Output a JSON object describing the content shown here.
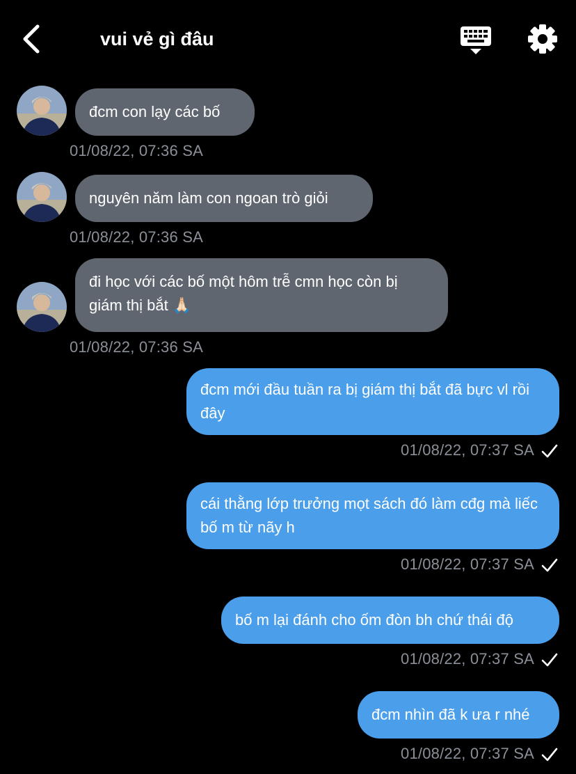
{
  "header": {
    "title": "vui vẻ gì đâu",
    "back_icon": "chevron-left-icon",
    "keyboard_icon": "keyboard-icon",
    "settings_icon": "gear-icon"
  },
  "colors": {
    "background": "#000000",
    "incoming_bubble": "#5f6670",
    "outgoing_bubble": "#4a9eea",
    "timestamp": "#8a8f98",
    "text": "#ffffff"
  },
  "messages": [
    {
      "direction": "in",
      "text": "đcm con lạy các bố",
      "time": "01/08/22, 07:36 SA"
    },
    {
      "direction": "in",
      "text": "nguyên năm làm con ngoan trò giỏi",
      "time": "01/08/22, 07:36 SA"
    },
    {
      "direction": "in",
      "text": "đi học với các bố một hôm trễ cmn học còn bị giám thị bắt 🙏🏻",
      "time": "01/08/22, 07:36 SA"
    },
    {
      "direction": "out",
      "text": "đcm mới đầu tuần ra bị giám thị bắt đã bực vl rồi đây",
      "time": "01/08/22, 07:37 SA",
      "status_icon": "checkmark-icon"
    },
    {
      "direction": "out",
      "text": "cái thằng lớp trưởng mọt sách đó làm cđg mà liếc bố m từ nãy h",
      "time": "01/08/22, 07:37 SA",
      "status_icon": "checkmark-icon"
    },
    {
      "direction": "out",
      "text": "bố m lại đánh cho ốm đòn bh chứ thái độ",
      "time": "01/08/22, 07:37 SA",
      "status_icon": "checkmark-icon"
    },
    {
      "direction": "out",
      "text": "đcm nhìn đã k ưa r nhé",
      "time": "01/08/22, 07:37 SA",
      "status_icon": "checkmark-icon"
    }
  ]
}
